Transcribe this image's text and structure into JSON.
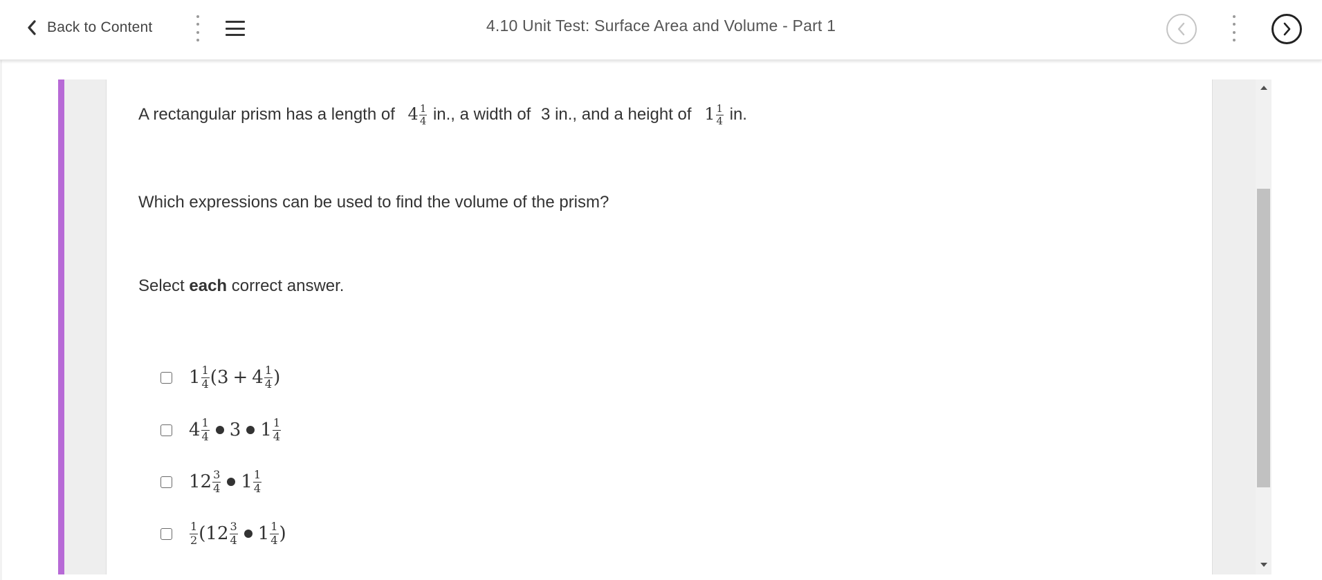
{
  "header": {
    "back_label": "Back to Content",
    "title": "4.10 Unit Test: Surface Area and Volume - Part 1"
  },
  "question": {
    "line1": {
      "text_a": "A rectangular prism has a length of",
      "length_whole": "4",
      "length_num": "1",
      "length_den": "4",
      "text_b": "in., a width of",
      "width": "3",
      "text_c": "in., and a height of",
      "height_whole": "1",
      "height_num": "1",
      "height_den": "4",
      "text_d": "in."
    },
    "prompt": "Which expressions can be used to find the volume of the prism?",
    "instruction": {
      "before": "Select",
      "bold": "each",
      "after": "correct answer."
    }
  },
  "options": [
    {
      "checked": false,
      "a_whole": "1",
      "a_num": "1",
      "a_den": "4",
      "open": "(",
      "b": "3",
      "plus": "+",
      "c_whole": "4",
      "c_num": "1",
      "c_den": "4",
      "close": ")"
    },
    {
      "checked": false,
      "a_whole": "4",
      "a_num": "1",
      "a_den": "4",
      "b": "3",
      "c_whole": "1",
      "c_num": "1",
      "c_den": "4"
    },
    {
      "checked": false,
      "a_whole": "12",
      "a_num": "3",
      "a_den": "4",
      "c_whole": "1",
      "c_num": "1",
      "c_den": "4"
    },
    {
      "checked": false,
      "h_num": "1",
      "h_den": "2",
      "open": "(",
      "a_whole": "12",
      "a_num": "3",
      "a_den": "4",
      "c_whole": "1",
      "c_num": "1",
      "c_den": "4",
      "close": ")"
    }
  ],
  "colors": {
    "accent": "#b76ad6",
    "gutter": "#eeeeee",
    "scroll_thumb": "#c1c1c1"
  },
  "icons": [
    "chevron-left-icon",
    "kebab-menu-icon",
    "hamburger-menu-icon",
    "previous-arrow-icon",
    "next-arrow-icon",
    "scroll-up-arrow-icon",
    "scroll-down-arrow-icon"
  ]
}
